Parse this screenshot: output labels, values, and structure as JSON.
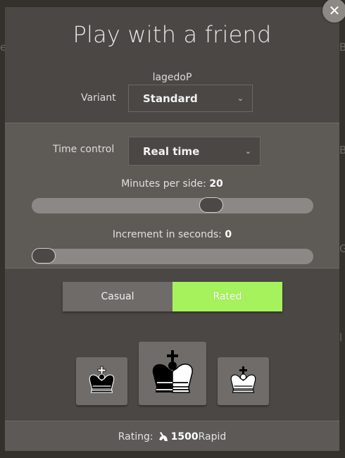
{
  "modal": {
    "title": "Play with a friend",
    "username": "lagedoP",
    "close_glyph": "✕"
  },
  "variant": {
    "label": "Variant",
    "value": "Standard",
    "chevron": "⌄"
  },
  "time_control": {
    "label": "Time control",
    "value": "Real time",
    "chevron": "⌄"
  },
  "minutes_slider": {
    "label": "Minutes per side: ",
    "value": "20",
    "position_fraction": 0.65
  },
  "increment_slider": {
    "label": "Increment in seconds: ",
    "value": "0",
    "position_fraction": 0.0
  },
  "mode": {
    "casual": "Casual",
    "rated": "Rated",
    "selected": "rated",
    "selected_color": "#a5f25c"
  },
  "colors": [
    {
      "name": "black",
      "icon": "black-king-icon"
    },
    {
      "name": "random",
      "icon": "half-king-icon"
    },
    {
      "name": "white",
      "icon": "white-king-icon"
    }
  ],
  "rating": {
    "prefix": "Rating: ",
    "value": "1500",
    "suffix": " Rapid",
    "icon": "rabbit-icon"
  },
  "background_edge": {
    "left_top": "e",
    "right_top": "B",
    "right_mid": "B",
    "right_lower": "G",
    "right_bottom": "l"
  }
}
